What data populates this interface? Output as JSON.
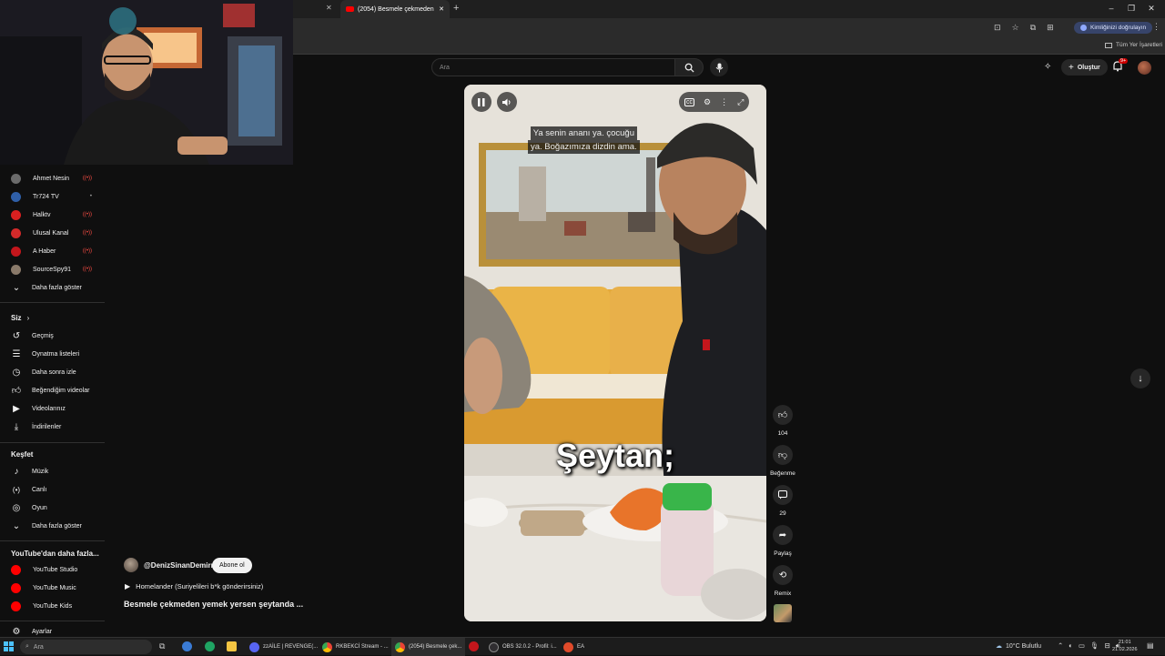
{
  "browser": {
    "tabs": [
      {
        "label": "(2054) Besmele çekmeden"
      }
    ],
    "new_tab": "+",
    "window_buttons": [
      "–",
      "❐",
      "✕"
    ],
    "profile_label": "Kimliğinizi doğrulayın",
    "bookmarks_label": "Tüm Yer İşaretleri"
  },
  "search": {
    "placeholder": "Ara"
  },
  "header": {
    "create_label": "Oluştur",
    "notifications_badge": "9+"
  },
  "sidebar": {
    "subscriptions": [
      {
        "name": "Ahmet Nesin",
        "color": "#6b6b6b",
        "live": true
      },
      {
        "name": "Tr724 TV",
        "color": "#2f5fa8",
        "live": false
      },
      {
        "name": "Halktv",
        "color": "#d92020",
        "live": true
      },
      {
        "name": "Ulusal Kanal",
        "color": "#d42a2a",
        "live": true
      },
      {
        "name": "A Haber",
        "color": "#c4161c",
        "live": true
      },
      {
        "name": "SourceSpy91",
        "color": "#8a7a6a",
        "live": true
      }
    ],
    "show_more": "Daha fazla göster",
    "you_heading": "Siz",
    "you_items": [
      {
        "label": "Geçmiş",
        "icon": "history-icon"
      },
      {
        "label": "Oynatma listeleri",
        "icon": "playlists-icon"
      },
      {
        "label": "Daha sonra izle",
        "icon": "watch-later-icon"
      },
      {
        "label": "Beğendiğim videolar",
        "icon": "liked-icon"
      },
      {
        "label": "Videolarınız",
        "icon": "your-videos-icon"
      },
      {
        "label": "İndirilenler",
        "icon": "downloads-icon"
      }
    ],
    "explore_heading": "Keşfet",
    "explore_items": [
      {
        "label": "Müzik",
        "icon": "music-icon"
      },
      {
        "label": "Canlı",
        "icon": "live-icon"
      },
      {
        "label": "Oyun",
        "icon": "gaming-icon"
      }
    ],
    "explore_more": "Daha fazla göster",
    "more_heading": "YouTube'dan daha fazla...",
    "more_items": [
      {
        "label": "YouTube Studio"
      },
      {
        "label": "YouTube Music"
      },
      {
        "label": "YouTube Kids"
      }
    ],
    "settings_label": "Ayarlar"
  },
  "video": {
    "subtitle_line1": "Ya senin ananı ya. çocuğu",
    "subtitle_line2": "ya. Boğazımıza dizdin ama.",
    "caption": "Şeytan;",
    "channel": "@DenizSinanDemirr",
    "subscribe_label": "Abone ol",
    "music_line": "Homelander (Suriyelileri b*k gönderirsiniz)",
    "title": "Besmele çekmeden yemek yersen şeytanda ..."
  },
  "actions": {
    "like_count": "104",
    "dislike_label": "Beğenme",
    "comment_count": "29",
    "share_label": "Paylaş",
    "remix_label": "Remix"
  },
  "taskbar": {
    "search_placeholder": "Ara",
    "apps": [
      {
        "label": "zzAİLE | REVENGE(..."
      },
      {
        "label": "RKBEKCİ Stream - ..."
      },
      {
        "label": "(2054) Besmele çek..."
      },
      {
        "label": "OBS 32.0.2 - Profil: i..."
      },
      {
        "label": "EA"
      }
    ],
    "weather": "10°C Bulutlu",
    "time": "21:01",
    "date": "21.02.2026"
  },
  "colors": {
    "background": "#0f0f0f",
    "accent_red": "#ff0000",
    "live_red": "#ff4e45"
  }
}
